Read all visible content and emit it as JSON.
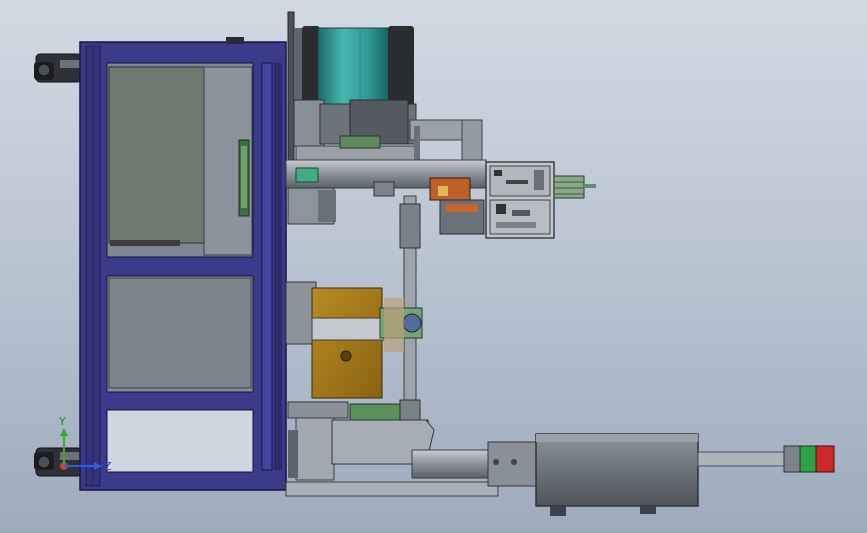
{
  "view": {
    "type": "cad-model-view",
    "background": {
      "top": "#d3d9e3",
      "middle": "#bac5d3",
      "bottom": "#9dabbd"
    }
  },
  "triad": {
    "y_label": "Y",
    "z_label": "Z",
    "y_color": "#2bb32b",
    "z_color": "#2b5fe6",
    "x_color": "#d23a3a"
  },
  "colors": {
    "frame": "#3b3b8c",
    "frame_edge": "#16163f",
    "steel": "#7e8590",
    "steel_light": "#a7adb6",
    "steel_dark": "#4a4f56",
    "teal": "#3ba8a2",
    "brass": "#a67b1a",
    "green_part": "#7aa67a",
    "light_green": "#33a64d",
    "red": "#cc2a2a",
    "orange": "#c5662f"
  }
}
